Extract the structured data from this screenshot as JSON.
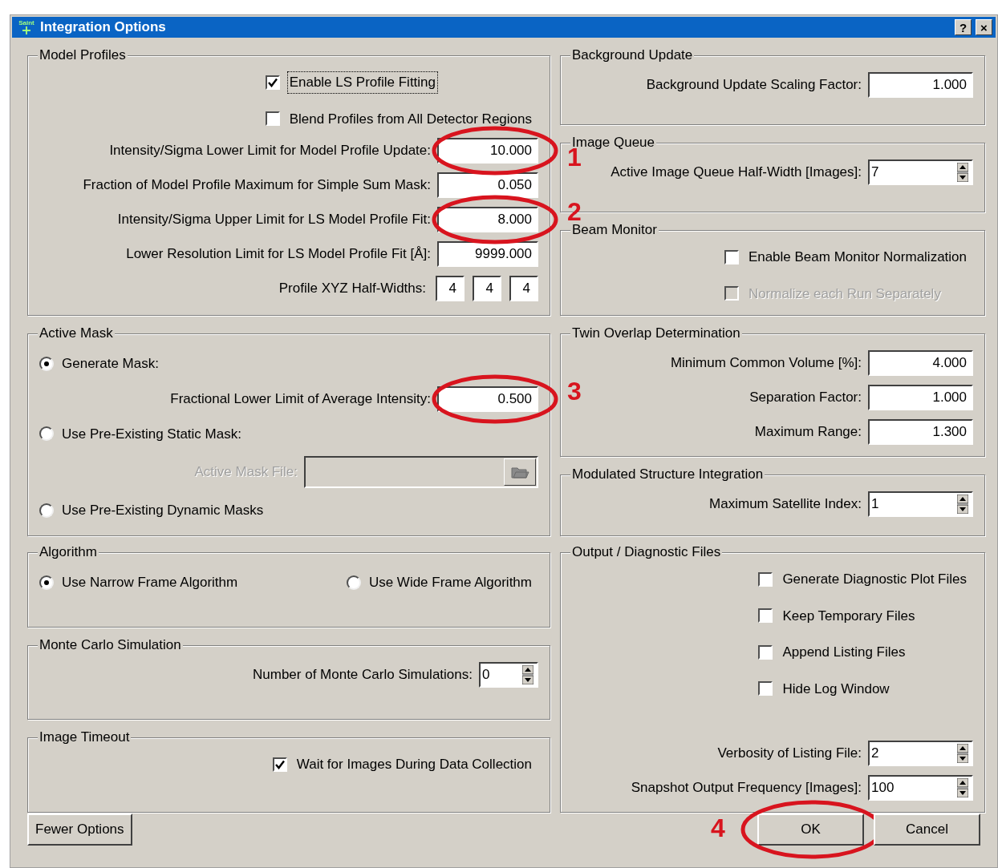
{
  "window": {
    "icon_text": "Saint",
    "title": "Integration Options",
    "buttons": [
      "?",
      "×"
    ]
  },
  "bands": [
    {
      "left": [
        {
          "title": "Model Profiles",
          "items": [
            {
              "kind": "checkbox",
              "label": "Enable LS Profile Fitting",
              "checked": true,
              "disabled": false,
              "focused": true
            },
            {
              "kind": "checkbox",
              "label": "Blend Profiles from All Detector Regions",
              "checked": false,
              "disabled": false,
              "focused": false
            },
            {
              "kind": "field",
              "label": "Intensity/Sigma Lower Limit for Model Profile Update:",
              "value": "10.000",
              "spinner": false,
              "callout": "1"
            },
            {
              "kind": "field",
              "label": "Fraction of Model Profile Maximum for Simple Sum Mask:",
              "value": "0.050",
              "spinner": false
            },
            {
              "kind": "field",
              "label": "Intensity/Sigma Upper Limit for LS Model Profile Fit:",
              "value": "8.000",
              "spinner": false,
              "callout": "2"
            },
            {
              "kind": "field",
              "label": "Lower Resolution Limit for LS Model Profile Fit [Å]:",
              "value": "9999.000",
              "spinner": false
            },
            {
              "kind": "triple",
              "label": "Profile XYZ Half-Widths:",
              "values": [
                "4",
                "4",
                "4"
              ]
            }
          ]
        }
      ],
      "right": [
        {
          "title": "Background Update",
          "items": [
            {
              "kind": "field",
              "label": "Background Update Scaling Factor:",
              "value": "1.000",
              "spinner": false
            }
          ]
        },
        {
          "title": "Image Queue",
          "items": [
            {
              "kind": "field",
              "label": "Active Image Queue Half-Width [Images]:",
              "value": "7",
              "spinner": true
            }
          ]
        },
        {
          "title": "Beam Monitor",
          "items": [
            {
              "kind": "checkbox",
              "label": "Enable Beam Monitor Normalization",
              "checked": false,
              "disabled": false,
              "focused": false
            },
            {
              "kind": "checkbox",
              "label": "Normalize each Run Separately",
              "checked": false,
              "disabled": true,
              "focused": false
            }
          ]
        }
      ]
    },
    {
      "left": [
        {
          "title": "Active Mask",
          "items": [
            {
              "kind": "radio",
              "label": "Generate Mask:",
              "selected": true
            },
            {
              "kind": "field",
              "label": "Fractional Lower Limit of Average Intensity:",
              "value": "0.500",
              "spinner": false,
              "callout": "3"
            },
            {
              "kind": "radio",
              "label": "Use Pre-Existing Static Mask:",
              "selected": false
            },
            {
              "kind": "file",
              "label": "Active Mask File:",
              "disabled": true
            },
            {
              "kind": "radio",
              "label": "Use Pre-Existing Dynamic Masks",
              "selected": false
            }
          ]
        }
      ],
      "right": [
        {
          "title": "Twin Overlap Determination",
          "items": [
            {
              "kind": "field",
              "label": "Minimum Common Volume [%]:",
              "value": "4.000",
              "spinner": false
            },
            {
              "kind": "field",
              "label": "Separation Factor:",
              "value": "1.000",
              "spinner": false
            },
            {
              "kind": "field",
              "label": "Maximum Range:",
              "value": "1.300",
              "spinner": false
            }
          ]
        },
        {
          "title": "Modulated Structure Integration",
          "items": [
            {
              "kind": "field",
              "label": "Maximum Satellite Index:",
              "value": "1",
              "spinner": true
            }
          ]
        }
      ]
    },
    {
      "left": [
        {
          "title": "Algorithm",
          "items": [
            {
              "kind": "radio_pair",
              "options": [
                {
                  "label": "Use Narrow Frame Algorithm",
                  "selected": true
                },
                {
                  "label": "Use Wide Frame Algorithm",
                  "selected": false
                }
              ]
            }
          ]
        },
        {
          "title": "Monte Carlo Simulation",
          "items": [
            {
              "kind": "field",
              "label": "Number of Monte Carlo Simulations:",
              "value": "0",
              "spinner": true
            }
          ]
        },
        {
          "title": "Image Timeout",
          "items": [
            {
              "kind": "checkbox",
              "label": "Wait for Images During Data Collection",
              "checked": true,
              "disabled": false,
              "focused": false
            }
          ]
        }
      ],
      "right": [
        {
          "title": "Output / Diagnostic Files",
          "items": [
            {
              "kind": "checkbox",
              "label": "Generate Diagnostic Plot Files",
              "checked": false,
              "disabled": false,
              "focused": false
            },
            {
              "kind": "checkbox",
              "label": "Keep Temporary Files",
              "checked": false,
              "disabled": false,
              "focused": false
            },
            {
              "kind": "checkbox",
              "label": "Append Listing Files",
              "checked": false,
              "disabled": false,
              "focused": false
            },
            {
              "kind": "checkbox",
              "label": "Hide Log Window",
              "checked": false,
              "disabled": false,
              "focused": false
            },
            {
              "kind": "gap"
            },
            {
              "kind": "field",
              "label": "Verbosity of Listing File:",
              "value": "2",
              "spinner": true
            },
            {
              "kind": "field",
              "label": "Snapshot Output Frequency [Images]:",
              "value": "100",
              "spinner": true
            }
          ]
        }
      ]
    }
  ],
  "footer": {
    "left_button": "Fewer Options",
    "buttons": [
      {
        "label": "OK",
        "callout": "4"
      },
      {
        "label": "Cancel"
      }
    ]
  }
}
